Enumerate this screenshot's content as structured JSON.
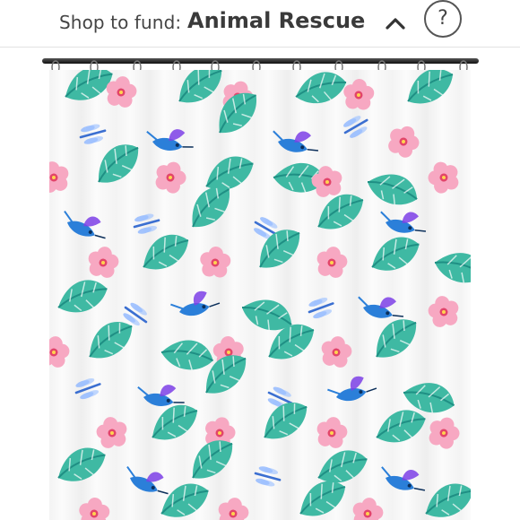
{
  "header": {
    "shop_label": "Shop to fund:",
    "fund_name": "Animal Rescue",
    "help_label": "?",
    "chevron_icon": "chevron-up-icon"
  },
  "product": {
    "colors": {
      "leaf": "#3fb9a3",
      "leaf_dark": "#1f8f84",
      "flower": "#f7a8c2",
      "flower_center": "#e2456a",
      "dragonfly": "#3b6fd1",
      "hummingbird": "#2b7fd9"
    }
  }
}
